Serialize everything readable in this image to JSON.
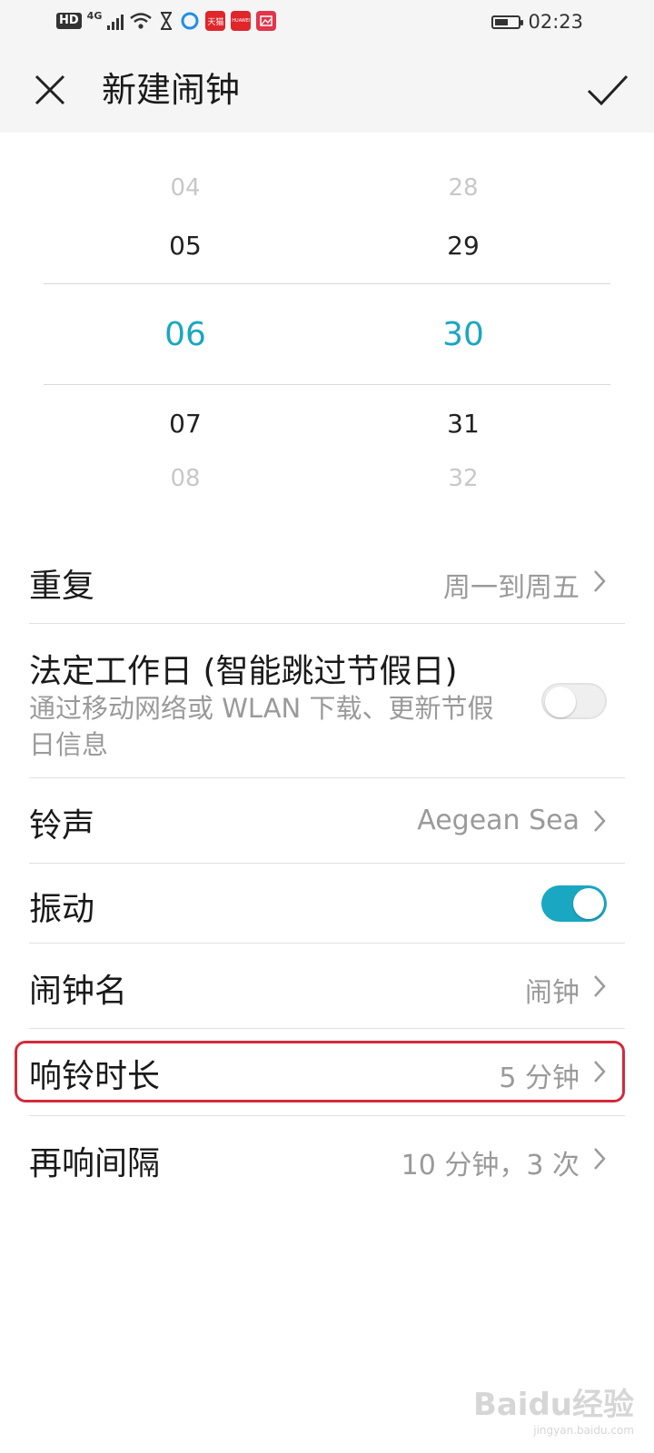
{
  "status_bar": {
    "hd_label": "HD",
    "network_label": "4G",
    "app_icons": [
      {
        "name": "tmall-app-icon",
        "label": "天猫",
        "color": "#e0252b"
      },
      {
        "name": "huawei-store-icon",
        "label": "HUAWEI",
        "color": "#e0252b"
      },
      {
        "name": "gallery-app-icon",
        "label": "",
        "color": "#e0364c"
      }
    ],
    "battery_level_percent": 60,
    "time": "02:23"
  },
  "header": {
    "title": "新建闹钟"
  },
  "time_picker": {
    "hours": [
      "04",
      "05",
      "06",
      "07",
      "08"
    ],
    "minutes": [
      "28",
      "29",
      "30",
      "31",
      "32"
    ],
    "selected_hour": "06",
    "selected_minute": "30",
    "accent_color": "#1aa7c1"
  },
  "settings": {
    "repeat": {
      "label": "重复",
      "value": "周一到周五"
    },
    "workday": {
      "label": "法定工作日 (智能跳过节假日)",
      "description": "通过移动网络或 WLAN 下载、更新节假日信息",
      "enabled": false
    },
    "ringtone": {
      "label": "铃声",
      "value": "Aegean Sea"
    },
    "vibrate": {
      "label": "振动",
      "enabled": true
    },
    "alarm_name": {
      "label": "闹钟名",
      "value": "闹钟"
    },
    "ring_duration": {
      "label": "响铃时长",
      "value": "5 分钟"
    },
    "snooze": {
      "label": "再响间隔",
      "value": "10 分钟，3 次"
    }
  },
  "highlight_color": "#d42a3c",
  "watermark": {
    "main": "Baidu经验",
    "sub": "jingyan.baidu.com"
  }
}
